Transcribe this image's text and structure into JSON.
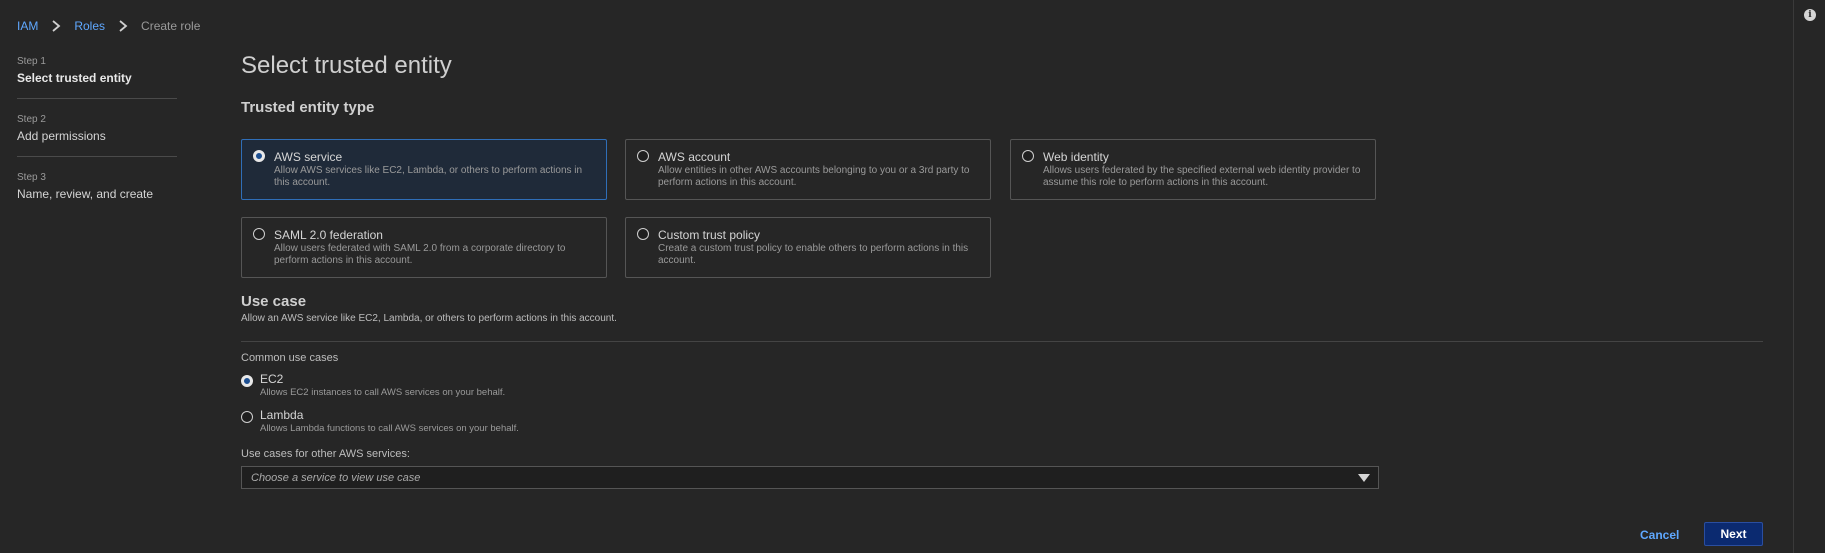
{
  "breadcrumb": {
    "items": [
      "IAM",
      "Roles"
    ],
    "current": "Create role"
  },
  "steps": [
    {
      "num": "Step 1",
      "label": "Select trusted entity",
      "active": true
    },
    {
      "num": "Step 2",
      "label": "Add permissions",
      "active": false
    },
    {
      "num": "Step 3",
      "label": "Name, review, and create",
      "active": false
    }
  ],
  "page": {
    "title": "Select trusted entity"
  },
  "trusted_entity": {
    "heading": "Trusted entity type",
    "selected": "AWS service",
    "options": [
      {
        "title": "AWS service",
        "desc": "Allow AWS services like EC2, Lambda, or others to perform actions in this account."
      },
      {
        "title": "AWS account",
        "desc": "Allow entities in other AWS accounts belonging to you or a 3rd party to perform actions in this account."
      },
      {
        "title": "Web identity",
        "desc": "Allows users federated by the specified external web identity provider to assume this role to perform actions in this account."
      },
      {
        "title": "SAML 2.0 federation",
        "desc": "Allow users federated with SAML 2.0 from a corporate directory to perform actions in this account."
      },
      {
        "title": "Custom trust policy",
        "desc": "Create a custom trust policy to enable others to perform actions in this account."
      }
    ]
  },
  "use_case": {
    "heading": "Use case",
    "desc": "Allow an AWS service like EC2, Lambda, or others to perform actions in this account.",
    "common_label": "Common use cases",
    "selected": "EC2",
    "options": [
      {
        "title": "EC2",
        "desc": "Allows EC2 instances to call AWS services on your behalf."
      },
      {
        "title": "Lambda",
        "desc": "Allows Lambda functions to call AWS services on your behalf."
      }
    ],
    "other_label": "Use cases for other AWS services:",
    "select_placeholder": "Choose a service to view use case"
  },
  "actions": {
    "cancel": "Cancel",
    "next": "Next"
  },
  "colors": {
    "background": "#262626",
    "link": "#5fa8ff",
    "selected_border": "#2f6eb8",
    "primary_button": "#0b2a70"
  }
}
